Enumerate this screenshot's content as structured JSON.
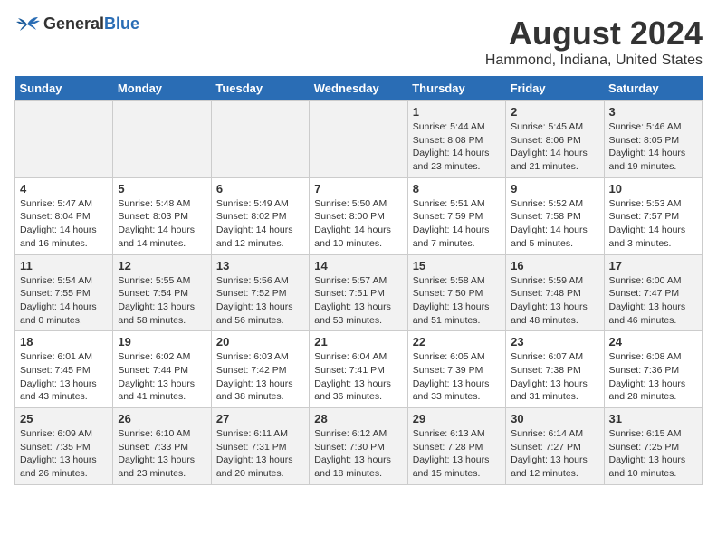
{
  "header": {
    "logo_general": "General",
    "logo_blue": "Blue",
    "title": "August 2024",
    "subtitle": "Hammond, Indiana, United States"
  },
  "days_of_week": [
    "Sunday",
    "Monday",
    "Tuesday",
    "Wednesday",
    "Thursday",
    "Friday",
    "Saturday"
  ],
  "weeks": [
    [
      {
        "day": "",
        "content": ""
      },
      {
        "day": "",
        "content": ""
      },
      {
        "day": "",
        "content": ""
      },
      {
        "day": "",
        "content": ""
      },
      {
        "day": "1",
        "content": "Sunrise: 5:44 AM\nSunset: 8:08 PM\nDaylight: 14 hours\nand 23 minutes."
      },
      {
        "day": "2",
        "content": "Sunrise: 5:45 AM\nSunset: 8:06 PM\nDaylight: 14 hours\nand 21 minutes."
      },
      {
        "day": "3",
        "content": "Sunrise: 5:46 AM\nSunset: 8:05 PM\nDaylight: 14 hours\nand 19 minutes."
      }
    ],
    [
      {
        "day": "4",
        "content": "Sunrise: 5:47 AM\nSunset: 8:04 PM\nDaylight: 14 hours\nand 16 minutes."
      },
      {
        "day": "5",
        "content": "Sunrise: 5:48 AM\nSunset: 8:03 PM\nDaylight: 14 hours\nand 14 minutes."
      },
      {
        "day": "6",
        "content": "Sunrise: 5:49 AM\nSunset: 8:02 PM\nDaylight: 14 hours\nand 12 minutes."
      },
      {
        "day": "7",
        "content": "Sunrise: 5:50 AM\nSunset: 8:00 PM\nDaylight: 14 hours\nand 10 minutes."
      },
      {
        "day": "8",
        "content": "Sunrise: 5:51 AM\nSunset: 7:59 PM\nDaylight: 14 hours\nand 7 minutes."
      },
      {
        "day": "9",
        "content": "Sunrise: 5:52 AM\nSunset: 7:58 PM\nDaylight: 14 hours\nand 5 minutes."
      },
      {
        "day": "10",
        "content": "Sunrise: 5:53 AM\nSunset: 7:57 PM\nDaylight: 14 hours\nand 3 minutes."
      }
    ],
    [
      {
        "day": "11",
        "content": "Sunrise: 5:54 AM\nSunset: 7:55 PM\nDaylight: 14 hours\nand 0 minutes."
      },
      {
        "day": "12",
        "content": "Sunrise: 5:55 AM\nSunset: 7:54 PM\nDaylight: 13 hours\nand 58 minutes."
      },
      {
        "day": "13",
        "content": "Sunrise: 5:56 AM\nSunset: 7:52 PM\nDaylight: 13 hours\nand 56 minutes."
      },
      {
        "day": "14",
        "content": "Sunrise: 5:57 AM\nSunset: 7:51 PM\nDaylight: 13 hours\nand 53 minutes."
      },
      {
        "day": "15",
        "content": "Sunrise: 5:58 AM\nSunset: 7:50 PM\nDaylight: 13 hours\nand 51 minutes."
      },
      {
        "day": "16",
        "content": "Sunrise: 5:59 AM\nSunset: 7:48 PM\nDaylight: 13 hours\nand 48 minutes."
      },
      {
        "day": "17",
        "content": "Sunrise: 6:00 AM\nSunset: 7:47 PM\nDaylight: 13 hours\nand 46 minutes."
      }
    ],
    [
      {
        "day": "18",
        "content": "Sunrise: 6:01 AM\nSunset: 7:45 PM\nDaylight: 13 hours\nand 43 minutes."
      },
      {
        "day": "19",
        "content": "Sunrise: 6:02 AM\nSunset: 7:44 PM\nDaylight: 13 hours\nand 41 minutes."
      },
      {
        "day": "20",
        "content": "Sunrise: 6:03 AM\nSunset: 7:42 PM\nDaylight: 13 hours\nand 38 minutes."
      },
      {
        "day": "21",
        "content": "Sunrise: 6:04 AM\nSunset: 7:41 PM\nDaylight: 13 hours\nand 36 minutes."
      },
      {
        "day": "22",
        "content": "Sunrise: 6:05 AM\nSunset: 7:39 PM\nDaylight: 13 hours\nand 33 minutes."
      },
      {
        "day": "23",
        "content": "Sunrise: 6:07 AM\nSunset: 7:38 PM\nDaylight: 13 hours\nand 31 minutes."
      },
      {
        "day": "24",
        "content": "Sunrise: 6:08 AM\nSunset: 7:36 PM\nDaylight: 13 hours\nand 28 minutes."
      }
    ],
    [
      {
        "day": "25",
        "content": "Sunrise: 6:09 AM\nSunset: 7:35 PM\nDaylight: 13 hours\nand 26 minutes."
      },
      {
        "day": "26",
        "content": "Sunrise: 6:10 AM\nSunset: 7:33 PM\nDaylight: 13 hours\nand 23 minutes."
      },
      {
        "day": "27",
        "content": "Sunrise: 6:11 AM\nSunset: 7:31 PM\nDaylight: 13 hours\nand 20 minutes."
      },
      {
        "day": "28",
        "content": "Sunrise: 6:12 AM\nSunset: 7:30 PM\nDaylight: 13 hours\nand 18 minutes."
      },
      {
        "day": "29",
        "content": "Sunrise: 6:13 AM\nSunset: 7:28 PM\nDaylight: 13 hours\nand 15 minutes."
      },
      {
        "day": "30",
        "content": "Sunrise: 6:14 AM\nSunset: 7:27 PM\nDaylight: 13 hours\nand 12 minutes."
      },
      {
        "day": "31",
        "content": "Sunrise: 6:15 AM\nSunset: 7:25 PM\nDaylight: 13 hours\nand 10 minutes."
      }
    ]
  ]
}
